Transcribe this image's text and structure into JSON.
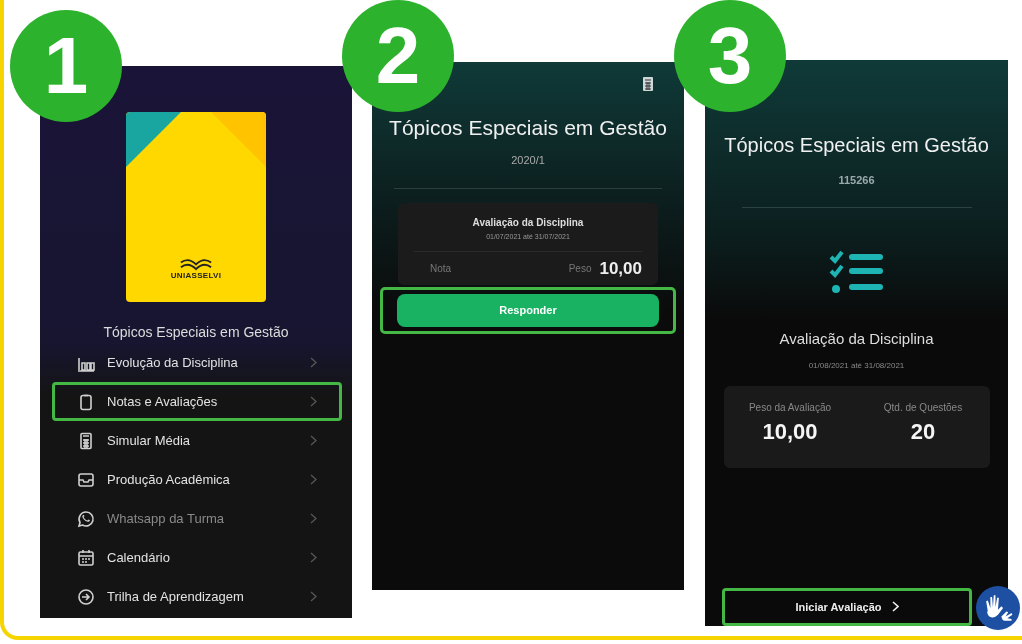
{
  "screens": [
    {
      "kind": "menu",
      "step": "1",
      "logo_text": "UNIASSELVI",
      "course_title": "Tópicos Especiais em Gestão",
      "menu": [
        {
          "label": "Evolução da Disciplina",
          "highlighted": false,
          "disabled": false
        },
        {
          "label": "Notas e Avaliações",
          "highlighted": true,
          "disabled": false
        },
        {
          "label": "Simular Média",
          "highlighted": false,
          "disabled": false
        },
        {
          "label": "Produção Acadêmica",
          "highlighted": false,
          "disabled": false
        },
        {
          "label": "Whatsapp da Turma",
          "highlighted": false,
          "disabled": true
        },
        {
          "label": "Calendário",
          "highlighted": false,
          "disabled": false
        },
        {
          "label": "Trilha de Aprendizagem",
          "highlighted": false,
          "disabled": false
        }
      ]
    },
    {
      "kind": "list",
      "step": "2",
      "title": "Tópicos Especiais em Gestão",
      "term": "2020/1",
      "card": {
        "title": "Avaliação da Disciplina",
        "dates": "01/07/2021 até 31/07/2021",
        "grade_label": "Nota",
        "weight_label": "Peso",
        "weight_value": "10,00"
      },
      "button": {
        "label": "Responder",
        "highlighted": true
      }
    },
    {
      "kind": "detail",
      "step": "3",
      "title": "Tópicos Especiais em Gestão",
      "code": "115266",
      "assessment_title": "Avaliação da Disciplina",
      "dates": "01/08/2021 até 31/08/2021",
      "stats": [
        {
          "label": "Peso da Avaliação",
          "value": "10,00"
        },
        {
          "label": "Qtd. de Questões",
          "value": "20"
        }
      ],
      "button": {
        "label": "Iniciar Avaliação",
        "highlighted": true
      }
    }
  ]
}
